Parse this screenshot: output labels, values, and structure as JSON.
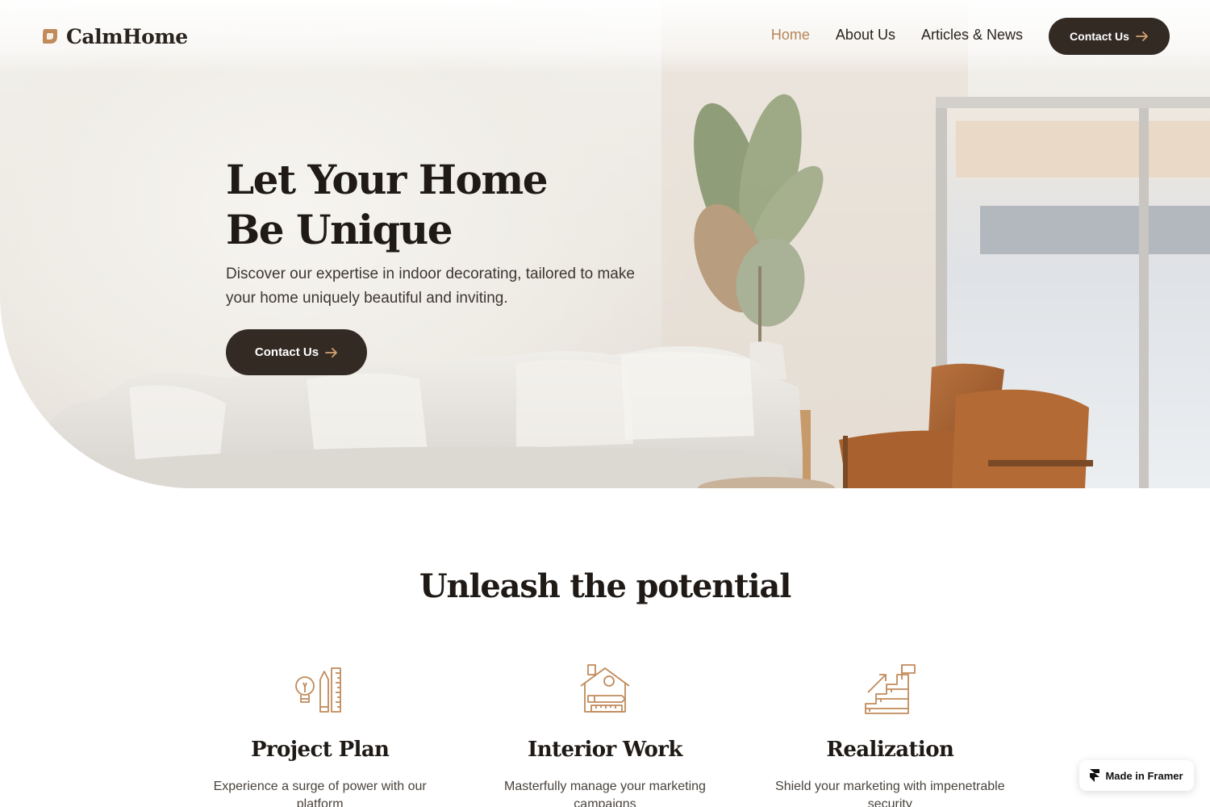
{
  "brand": {
    "name": "CalmHome",
    "accent": "#b5865a",
    "dark": "#332a24"
  },
  "nav": {
    "links": [
      {
        "label": "Home",
        "active": true
      },
      {
        "label": "About Us",
        "active": false
      },
      {
        "label": "Articles & News",
        "active": false
      }
    ],
    "cta_label": "Contact Us",
    "cta_icon": "arrow-right-icon"
  },
  "hero": {
    "title_line1": "Let Your Home",
    "title_line2": "Be Unique",
    "subtitle": "Discover our expertise in indoor decorating, tailored to make your home uniquely beautiful and inviting.",
    "cta_label": "Contact Us",
    "cta_icon": "arrow-right-icon"
  },
  "section": {
    "title": "Unleash the potential",
    "features": [
      {
        "icon": "lightbulb-pencil-ruler-icon",
        "title": "Project Plan",
        "desc": "Experience a surge of power with our platform"
      },
      {
        "icon": "house-blueprint-icon",
        "title": "Interior Work",
        "desc": "Masterfully manage your marketing campaigns"
      },
      {
        "icon": "stairs-growth-icon",
        "title": "Realization",
        "desc": "Shield your marketing with impenetrable security"
      }
    ]
  },
  "badge": {
    "label": "Made in Framer",
    "icon": "framer-icon"
  }
}
